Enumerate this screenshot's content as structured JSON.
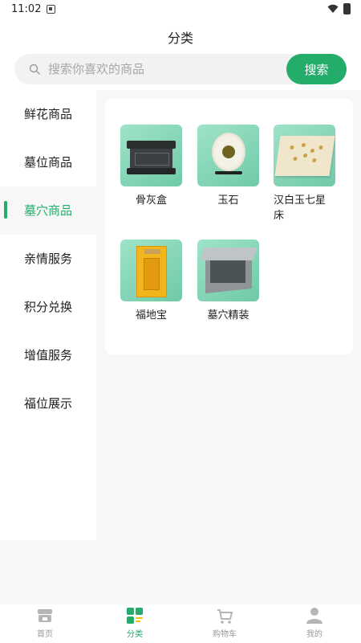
{
  "status_bar": {
    "time": "11:02"
  },
  "header": {
    "title": "分类"
  },
  "search": {
    "placeholder": "搜索你喜欢的商品",
    "button_label": "搜索"
  },
  "sidebar": {
    "items": [
      {
        "label": "鲜花商品"
      },
      {
        "label": "墓位商品"
      },
      {
        "label": "墓穴商品",
        "active": true
      },
      {
        "label": "亲情服务"
      },
      {
        "label": "积分兑换"
      },
      {
        "label": "增值服务"
      },
      {
        "label": "福位展示"
      }
    ]
  },
  "products": [
    {
      "name": "骨灰盒",
      "icon": "urn-image"
    },
    {
      "name": "玉石",
      "icon": "jade-image"
    },
    {
      "name": "汉白玉七星床",
      "icon": "stone-bed-image"
    },
    {
      "name": "福地宝",
      "icon": "bag-image"
    },
    {
      "name": "墓穴精装",
      "icon": "tomb-box-image"
    }
  ],
  "tabbar": {
    "tabs": [
      {
        "label": "首页",
        "icon": "home-icon"
      },
      {
        "label": "分类",
        "icon": "category-icon",
        "active": true
      },
      {
        "label": "购物车",
        "icon": "cart-icon"
      },
      {
        "label": "我的",
        "icon": "user-icon"
      }
    ]
  },
  "colors": {
    "accent": "#24ac6b",
    "thumb": "#8fd9bb"
  }
}
